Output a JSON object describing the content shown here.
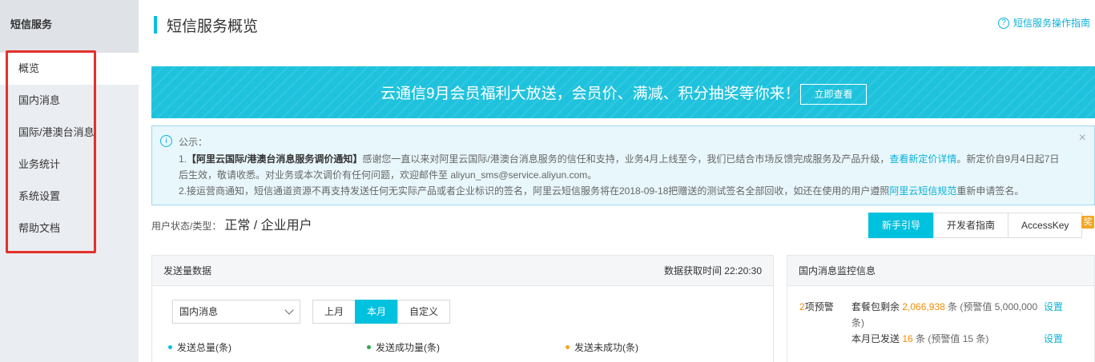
{
  "sidebar": {
    "title": "短信服务",
    "items": [
      {
        "label": "概览"
      },
      {
        "label": "国内消息"
      },
      {
        "label": "国际/港澳台消息"
      },
      {
        "label": "业务统计"
      },
      {
        "label": "系统设置"
      },
      {
        "label": "帮助文档"
      }
    ]
  },
  "header": {
    "title": "短信服务概览",
    "guide_icon": "?",
    "guide_link": "短信服务操作指南"
  },
  "banner": {
    "text": "云通信9月会员福利大放送，会员价、满减、积分抽奖等你来！",
    "button": "立即查看"
  },
  "notice": {
    "icon": "i",
    "label": "公示：",
    "close": "×",
    "line1_prefix": "1.",
    "line1_bold": "【阿里云国际/港澳台消息服务调价通知】",
    "line1_text": "感谢您一直以来对阿里云国际/港澳台消息服务的信任和支持，业务4月上线至今，我们已结合市场反馈完成服务及产品升级，",
    "line1_link": "查看新定价详情",
    "line1_suffix": "。新定价自9月4日起7日",
    "line2": "后生效，敬请收悉。对业务或本次调价有任何问题，欢迎邮件至 aliyun_sms@service.aliyun.com。",
    "line3_text": "2.接运营商通知，短信通道资源不再支持发送任何无实际产品或者企业标识的签名，阿里云短信服务将在2018-09-18把赠送的测试签名全部回收，如还在使用的用户遵照",
    "line3_link": "阿里云短信规范",
    "line3_suffix": "重新申请签名。"
  },
  "status": {
    "label": "用户状态/类型：",
    "value": "正常 / 企业用户"
  },
  "tabs": [
    "新手引导",
    "开发者指南",
    "AccessKey"
  ],
  "award_badge": "奖",
  "send_panel": {
    "title": "发送量数据",
    "fetch_time": "数据获取时间 22:20:30",
    "select_value": "国内消息",
    "ranges": [
      "上月",
      "本月",
      "自定义"
    ],
    "legend": [
      {
        "label": "发送总量(条)",
        "color": "#00c1de"
      },
      {
        "label": "发送成功量(条)",
        "color": "#2fa84f"
      },
      {
        "label": "发送未成功(条)",
        "color": "#f5a623"
      }
    ]
  },
  "monitor_panel": {
    "title": "国内消息监控信息",
    "alert_num": "2",
    "alert_text": "项预警",
    "line1_a": "套餐包剩余",
    "line1_value": "2,066,938",
    "line1_b": "条 (预警值 5,000,000",
    "line1_c": "条)",
    "line2_a": "本月已发送",
    "line2_value": "16",
    "line2_b": "条 (预警值 15 条)",
    "set_label": "设置"
  }
}
